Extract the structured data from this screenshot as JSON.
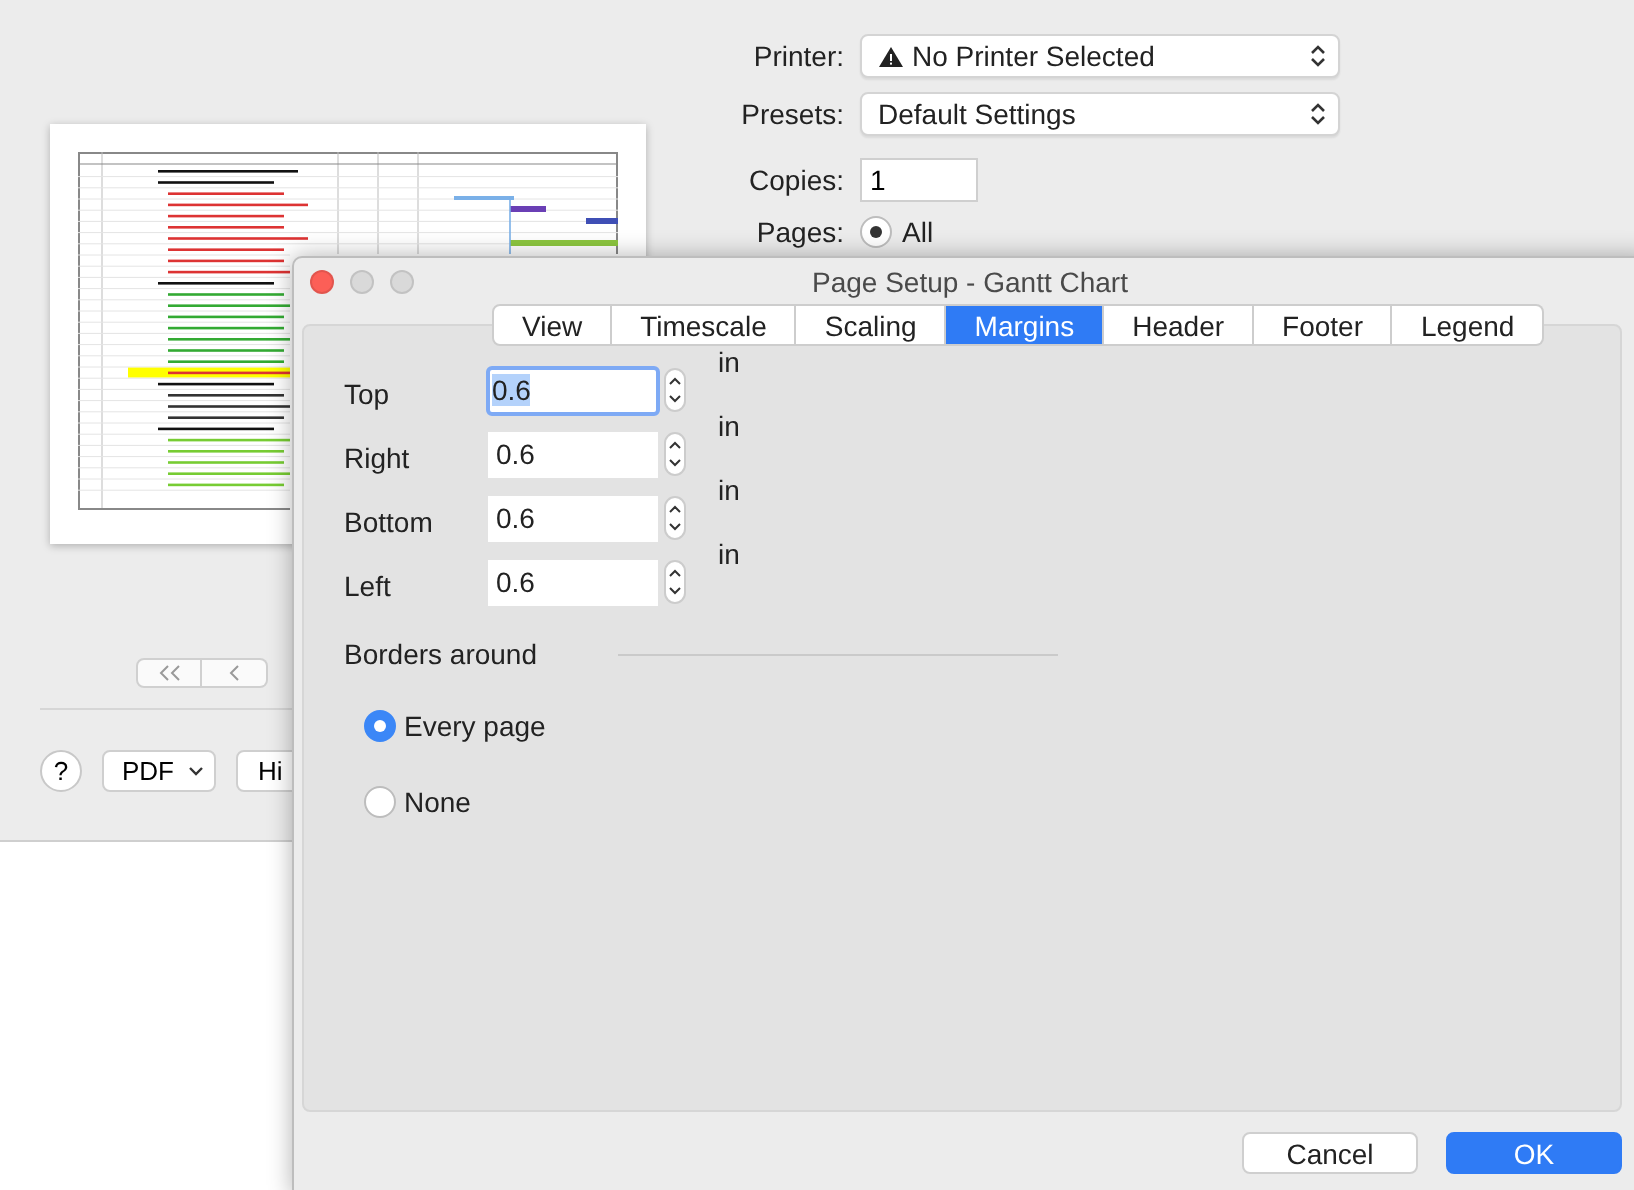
{
  "print_dialog": {
    "printer": {
      "label": "Printer:",
      "value": "No Printer Selected"
    },
    "presets": {
      "label": "Presets:",
      "value": "Default Settings"
    },
    "copies": {
      "label": "Copies:",
      "value": "1"
    },
    "pages": {
      "label": "Pages:",
      "option": "All",
      "selected": true
    },
    "help": "?",
    "pdf": "PDF",
    "hide_details": "Hi"
  },
  "page_setup": {
    "title": "Page Setup - Gantt Chart",
    "tabs": [
      {
        "label": "View",
        "selected": false
      },
      {
        "label": "Timescale",
        "selected": false
      },
      {
        "label": "Scaling",
        "selected": false
      },
      {
        "label": "Margins",
        "selected": true
      },
      {
        "label": "Header",
        "selected": false
      },
      {
        "label": "Footer",
        "selected": false
      },
      {
        "label": "Legend",
        "selected": false
      }
    ],
    "margins": [
      {
        "label": "Top",
        "value": "0.6",
        "unit": "in",
        "focused": true
      },
      {
        "label": "Right",
        "value": "0.6",
        "unit": "in",
        "focused": false
      },
      {
        "label": "Bottom",
        "value": "0.6",
        "unit": "in",
        "focused": false
      },
      {
        "label": "Left",
        "value": "0.6",
        "unit": "in",
        "focused": false
      }
    ],
    "borders": {
      "label": "Borders around",
      "options": [
        {
          "label": "Every page",
          "selected": true
        },
        {
          "label": "None",
          "selected": false
        }
      ]
    },
    "buttons": [
      {
        "label": "Cancel",
        "kind": "secondary"
      },
      {
        "label": "OK",
        "kind": "primary"
      }
    ]
  }
}
